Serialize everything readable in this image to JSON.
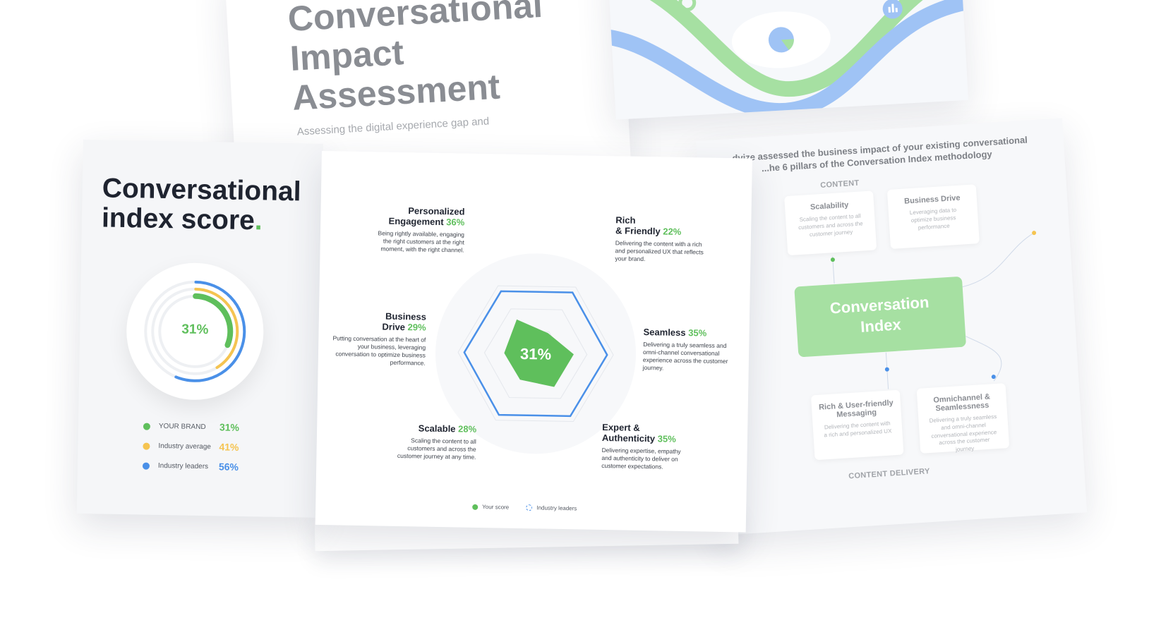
{
  "cover": {
    "title_line1": "Conversational",
    "title_line2": "Impact",
    "title_line3": "Assessment",
    "subtitle": "Assessing the digital experience gap and"
  },
  "methodology": {
    "intro_line1": "...dvize assessed the business impact of your existing conversational",
    "intro_line2": "...he 6 pillars of the Conversation Index methodology",
    "content_label": "CONTENT",
    "delivery_label": "CONTENT DELIVERY",
    "center_line1": "Conversation",
    "center_line2": "Index",
    "pills": [
      {
        "title": "Scalability",
        "text": "Scaling the content to all customers and across the customer journey"
      },
      {
        "title": "Business Drive",
        "text": "Leveraging data to optimize business performance"
      },
      {
        "title": "Rich & User-friendly Messaging",
        "text": "Delivering the content with a rich and personalized UX"
      },
      {
        "title": "Omnichannel & Seamlessness",
        "text": "Delivering a truly seamless and omni-channel conversational experience across the customer journey"
      }
    ]
  },
  "score": {
    "title_line1": "Conversational",
    "title_line2": "index score",
    "title_dot": ".",
    "center_value": "31%",
    "legend": [
      {
        "label": "YOUR BRAND",
        "value": "31%",
        "color": "#5fbf5c"
      },
      {
        "label": "Industry average",
        "value": "41%",
        "color": "#f5c451"
      },
      {
        "label": "Industry leaders",
        "value": "56%",
        "color": "#4a90e8"
      }
    ]
  },
  "radar": {
    "center_value": "31%",
    "pillars": {
      "personalized": {
        "name1": "Personalized",
        "name2": "Engagement",
        "pct": "36%",
        "desc": "Being rightly available, engaging the right customers at the right moment, with the right channel."
      },
      "rich": {
        "name1": "Rich",
        "name2": "& Friendly",
        "pct": "22%",
        "desc": "Delivering the content with a rich and personalized UX that reflects your brand."
      },
      "business": {
        "name1": "Business",
        "name2": "Drive",
        "pct": "29%",
        "desc": "Putting conversation at the heart of your business, leveraging conversation to optimize business performance."
      },
      "seamless": {
        "name1": "Seamless",
        "pct": "35%",
        "desc": "Delivering a truly seamless and omni-channel conversational experience across the customer journey."
      },
      "scalable": {
        "name1": "Scalable",
        "pct": "28%",
        "desc": "Scaling the content to all customers and across the customer journey at any time."
      },
      "expert": {
        "name1": "Expert &",
        "name2": "Authenticity",
        "pct": "35%",
        "desc": "Delivering expertise, empathy and authenticity to deliver on customer expectations."
      }
    },
    "legend_your": "Your score",
    "legend_leaders": "Industry leaders"
  },
  "colors": {
    "green": "#5fbf5c",
    "yellow": "#f5c451",
    "blue": "#4a90e8",
    "light_green": "#a6e0a2"
  }
}
